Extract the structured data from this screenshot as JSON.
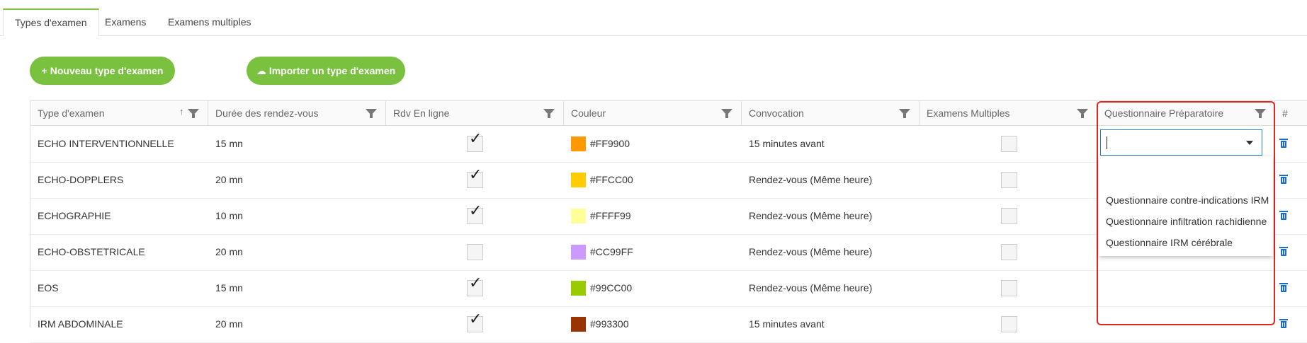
{
  "tabs": [
    {
      "label": "Types d'examen",
      "active": true
    },
    {
      "label": "Examens",
      "active": false
    },
    {
      "label": "Examens multiples",
      "active": false
    }
  ],
  "toolbar": {
    "new_label": "Nouveau type d'examen",
    "new_icon": "plus-icon",
    "import_label": "Importer un type d'examen",
    "import_icon": "cloud-upload-icon",
    "accent_color": "#79c13f"
  },
  "grid": {
    "columns": [
      {
        "label": "Type d'examen",
        "sortable": true,
        "filterable": true
      },
      {
        "label": "Durée des rendez-vous",
        "filterable": true
      },
      {
        "label": "Rdv En ligne",
        "filterable": true
      },
      {
        "label": "Couleur",
        "filterable": true
      },
      {
        "label": "Convocation",
        "filterable": true
      },
      {
        "label": "Examens Multiples",
        "filterable": true
      },
      {
        "label": "Questionnaire Préparatoire",
        "filterable": true
      },
      {
        "label": "#"
      }
    ],
    "rows": [
      {
        "type": "ECHO INTERVENTIONNELLE",
        "duree": "15 mn",
        "rdv_en_ligne": true,
        "couleur": "#FF9900",
        "convocation": "15 minutes avant",
        "examens_multiples": false
      },
      {
        "type": "ECHO-DOPPLERS",
        "duree": "20 mn",
        "rdv_en_ligne": true,
        "couleur": "#FFCC00",
        "convocation": "Rendez-vous (Même heure)",
        "examens_multiples": false
      },
      {
        "type": "ECHOGRAPHIE",
        "duree": "10 mn",
        "rdv_en_ligne": true,
        "couleur": "#FFFF99",
        "convocation": "Rendez-vous (Même heure)",
        "examens_multiples": false
      },
      {
        "type": "ECHO-OBSTETRICALE",
        "duree": "20 mn",
        "rdv_en_ligne": false,
        "couleur": "#CC99FF",
        "convocation": "Rendez-vous (Même heure)",
        "examens_multiples": false
      },
      {
        "type": "EOS",
        "duree": "15 mn",
        "rdv_en_ligne": true,
        "couleur": "#99CC00",
        "convocation": "Rendez-vous (Même heure)",
        "examens_multiples": false
      },
      {
        "type": "IRM ABDOMINALE",
        "duree": "20 mn",
        "rdv_en_ligne": true,
        "couleur": "#993300",
        "convocation": "15 minutes avant",
        "examens_multiples": false
      }
    ],
    "delete_icon": "trash-icon",
    "delete_color": "#1e6dc5"
  },
  "questionnaire_dropdown": {
    "value": "",
    "options": [
      "",
      "Questionnaire contre-indications IRM",
      "Questionnaire infiltration rachidienne",
      "Questionnaire IRM cérébrale"
    ],
    "highlight_color": "#e02525"
  }
}
